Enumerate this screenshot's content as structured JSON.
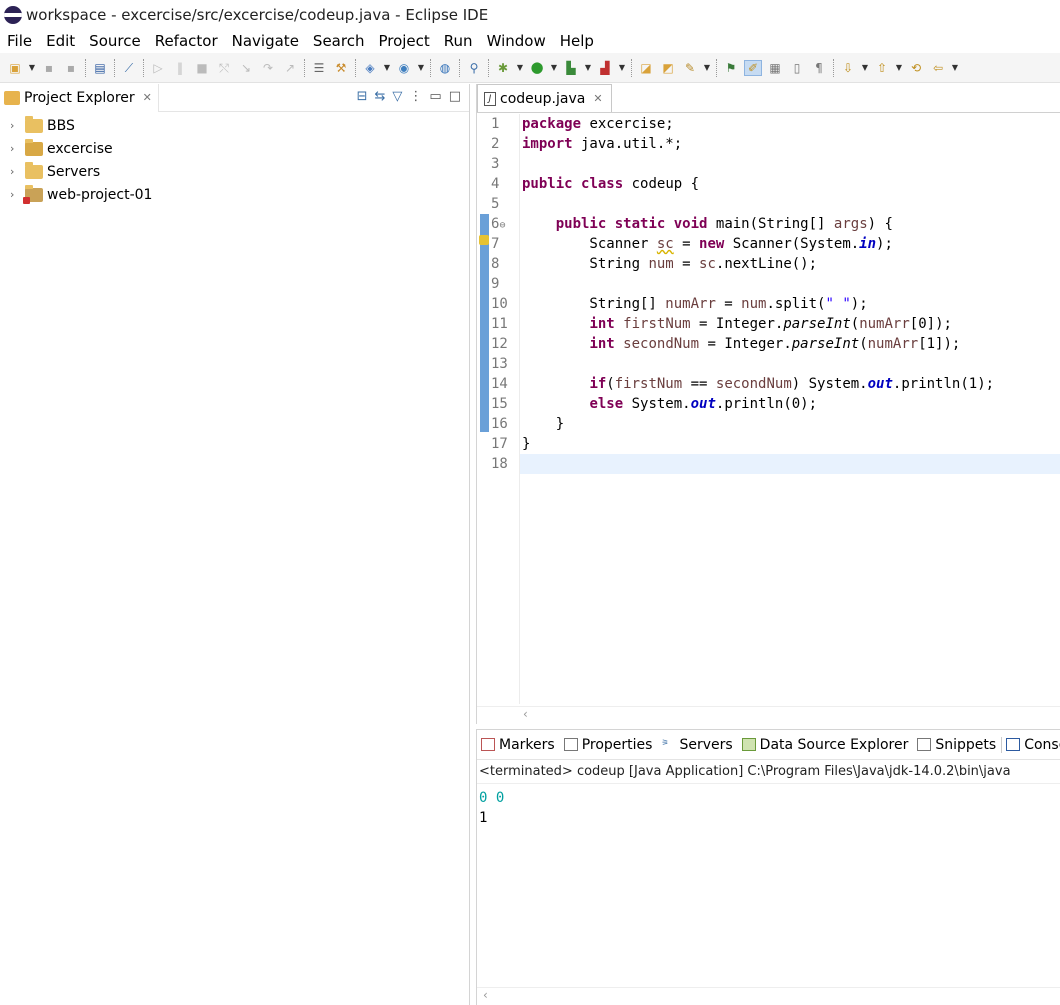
{
  "window": {
    "title": "workspace - excercise/src/excercise/codeup.java - Eclipse IDE"
  },
  "menu": [
    "File",
    "Edit",
    "Source",
    "Refactor",
    "Navigate",
    "Search",
    "Project",
    "Run",
    "Window",
    "Help"
  ],
  "project_explorer": {
    "tab_label": "Project Explorer",
    "items": [
      {
        "label": "BBS",
        "icon": "project-folder-icon"
      },
      {
        "label": "excercise",
        "icon": "java-project-icon"
      },
      {
        "label": "Servers",
        "icon": "folder-icon"
      },
      {
        "label": "web-project-01",
        "icon": "web-project-error-icon"
      }
    ]
  },
  "editor": {
    "tab_label": "codeup.java",
    "line_numbers": [
      "1",
      "2",
      "3",
      "4",
      "5",
      "6",
      "7",
      "8",
      "9",
      "10",
      "11",
      "12",
      "13",
      "14",
      "15",
      "16",
      "17",
      "18"
    ]
  },
  "bottom_panel": {
    "tabs": [
      "Markers",
      "Properties",
      "Servers",
      "Data Source Explorer",
      "Snippets",
      "Consc"
    ],
    "console_header": "<terminated> codeup [Java Application] C:\\Program Files\\Java\\jdk-14.0.2\\bin\\java",
    "console_input": "0 0",
    "console_output": "1"
  },
  "colors": {
    "keyword": "#7f0055",
    "static_field": "#0000c0",
    "string": "#2a00ff",
    "console_input": "#00a0a0",
    "current_line": "#e8f2fe"
  }
}
